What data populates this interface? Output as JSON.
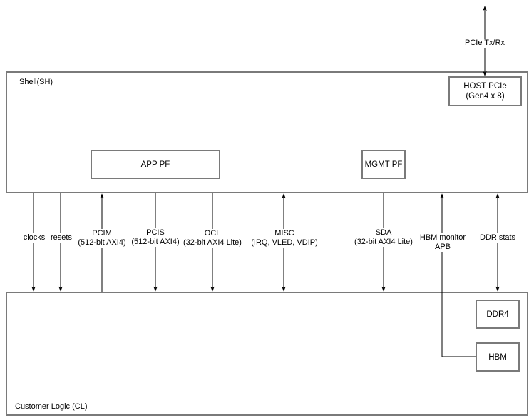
{
  "shell": {
    "title": "Shell(SH)"
  },
  "customer_logic": {
    "title": "Customer Logic (CL)"
  },
  "blocks": {
    "host_pcie": {
      "line1": "HOST PCIe",
      "line2": "(Gen4 x 8)"
    },
    "app_pf": "APP PF",
    "mgmt_pf": "MGMT PF",
    "ddr4": "DDR4",
    "hbm": "HBM"
  },
  "external_link": {
    "label": "PCIe Tx/Rx",
    "direction": "bidirectional"
  },
  "interfaces": [
    {
      "id": "clocks",
      "line1": "clocks",
      "line2": "",
      "direction": "SH->CL"
    },
    {
      "id": "resets",
      "line1": "resets",
      "line2": "",
      "direction": "SH->CL"
    },
    {
      "id": "pcim",
      "line1": "PCIM",
      "line2": "(512-bit AXI4)",
      "direction": "CL->SH"
    },
    {
      "id": "pcis",
      "line1": "PCIS",
      "line2": "(512-bit AXI4)",
      "direction": "SH->CL"
    },
    {
      "id": "ocl",
      "line1": "OCL",
      "line2": "(32-bit AXI4 Lite)",
      "direction": "SH->CL"
    },
    {
      "id": "misc",
      "line1": "MISC",
      "line2": "(IRQ, VLED, VDIP)",
      "direction": "bidirectional"
    },
    {
      "id": "sda",
      "line1": "SDA",
      "line2": "(32-bit AXI4 Lite)",
      "direction": "SH->CL"
    },
    {
      "id": "hbm-monitor",
      "line1": "HBM monitor",
      "line2": "APB",
      "direction": "HBM->SH"
    },
    {
      "id": "ddr-stats",
      "line1": "DDR stats",
      "line2": "",
      "direction": "bidirectional"
    }
  ]
}
